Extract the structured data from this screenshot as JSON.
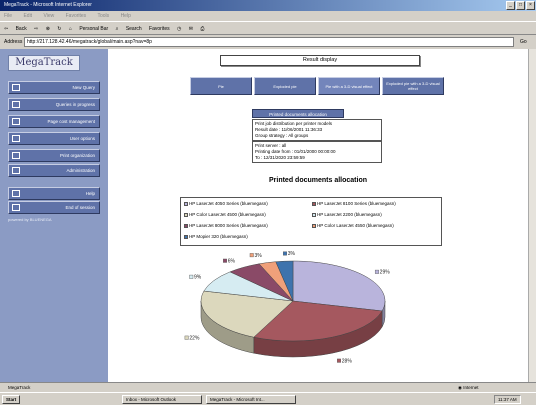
{
  "window": {
    "title": "MegaTrack - Microsoft Internet Explorer",
    "menu": [
      "File",
      "Edit",
      "View",
      "Favorites",
      "Tools",
      "Help"
    ],
    "toolbar": [
      "Back",
      "Personal Bar",
      "Search",
      "Favorites"
    ],
    "address_label": "Address",
    "address": "http://217.128.42.46/megatrack/global/main.asp?nav=8p",
    "go_label": "Go"
  },
  "sidebar": {
    "logo": "MegaTrack",
    "items": [
      {
        "label": "New Query"
      },
      {
        "label": "Queries in progress"
      },
      {
        "label": "Page cost management"
      },
      {
        "label": "User options"
      },
      {
        "label": "Print organization"
      },
      {
        "label": "Administration"
      },
      {
        "label": "Help"
      },
      {
        "label": "End of session"
      }
    ],
    "powered_by": "powered by BLUENEGA"
  },
  "main": {
    "result_title": "Result display",
    "chart_buttons": [
      {
        "label": "Pie"
      },
      {
        "label": "Exploded pie"
      },
      {
        "label": "Pie with a 3-D visual effect"
      },
      {
        "label": "Exploded pie with a 3-D visual effect"
      }
    ],
    "info_heading": "Printed documents allocation",
    "info_lines_1": [
      "Print job distribution per printer models",
      "Result date : 11/06/2001 11:36:33",
      "Group strategy : All groups"
    ],
    "info_lines_2": [
      "Print server : all",
      "Printing date from : 01/01/2000 00:00:00",
      "To : 12/31/2020 23:59:59"
    ]
  },
  "chart_data": {
    "type": "pie",
    "title": "Printed documents allocation",
    "categories": [
      "HP LaserJet 4050 Series  (bluemegasn)",
      "HP LaserJet 8100 Series (bluemegasn)",
      "HP Color LaserJet 4500 (bluemegasn)",
      "HP LaserJet 2200 (bluemegasn)",
      "HP LaserJet 8000 Series (bluemegasn)",
      "HP Color LaserJet 4550 (bluemegasn)",
      "HP Mopier 320 (bluemegasn)"
    ],
    "values": [
      29,
      28,
      22,
      9,
      6,
      3,
      3
    ],
    "data_labels": [
      "29%",
      "28%",
      "22%",
      "9%",
      "6%",
      "3%",
      "3%"
    ],
    "colors": [
      "#b9b4dc",
      "#a5585f",
      "#dcd8bd",
      "#d6ecf2",
      "#8a4a67",
      "#f0a07a",
      "#3e73ad"
    ],
    "legend_position": "top"
  },
  "status": {
    "left": "MegaTrack",
    "zone": "Internet"
  },
  "taskbar": {
    "start": "Start",
    "tasks": [
      "Inbox - Microsoft Outlook",
      "MegaTrack - Microsoft Int..."
    ],
    "clock": "11:37 AM"
  }
}
